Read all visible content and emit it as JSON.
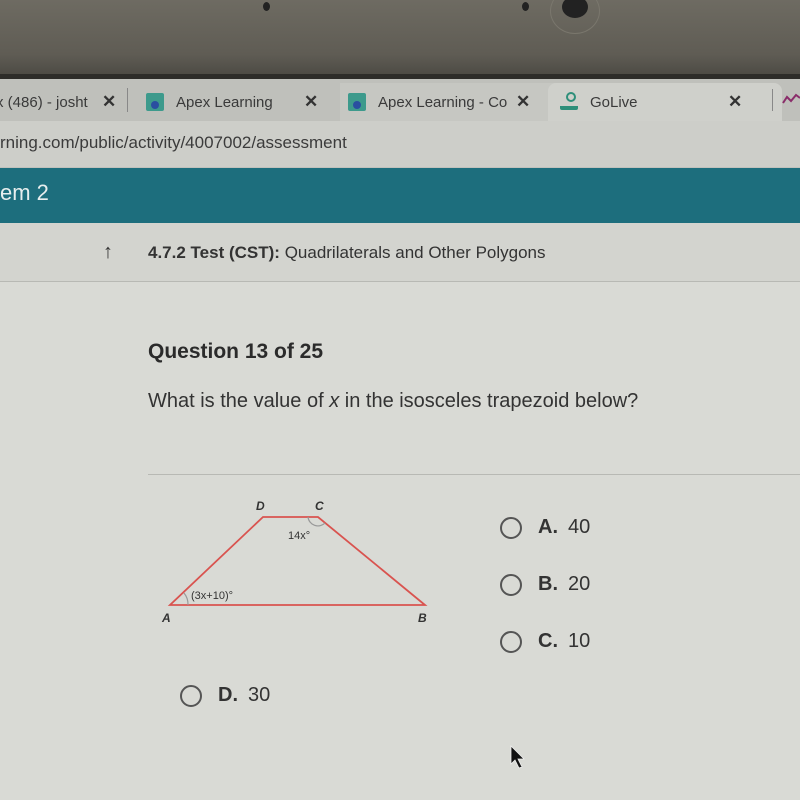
{
  "browser": {
    "tabs": [
      {
        "label": "x (486) - josht",
        "icon": "mail-icon",
        "active": false
      },
      {
        "label": "Apex Learning",
        "icon": "apex-favicon",
        "active": false
      },
      {
        "label": "Apex Learning - Co",
        "icon": "apex-favicon",
        "active": true
      },
      {
        "label": "GoLive",
        "icon": "golive-favicon",
        "active": false
      }
    ],
    "close_glyph": "✕",
    "url": "rning.com/public/activity/4007002/assessment"
  },
  "course_header": {
    "title": "em 2"
  },
  "breadcrumb": {
    "up_glyph": "↑",
    "code": "4.7.2",
    "type": "Test (CST):",
    "title": "Quadrilaterals and Other Polygons"
  },
  "question": {
    "number_label": "Question 13 of 25",
    "prompt_before": "What is the value of ",
    "prompt_var": "x",
    "prompt_after": " in the isosceles trapezoid below?"
  },
  "figure": {
    "vertices": {
      "A": "A",
      "B": "B",
      "C": "C",
      "D": "D"
    },
    "angle_A_label": "(3x+10)°",
    "angle_C_label": "14x°",
    "line_color": "#d9534f"
  },
  "options": [
    {
      "letter": "A.",
      "value": "40",
      "selected": false
    },
    {
      "letter": "B.",
      "value": "20",
      "selected": false
    },
    {
      "letter": "C.",
      "value": "10",
      "selected": false
    },
    {
      "letter": "D.",
      "value": "30",
      "selected": false
    }
  ]
}
